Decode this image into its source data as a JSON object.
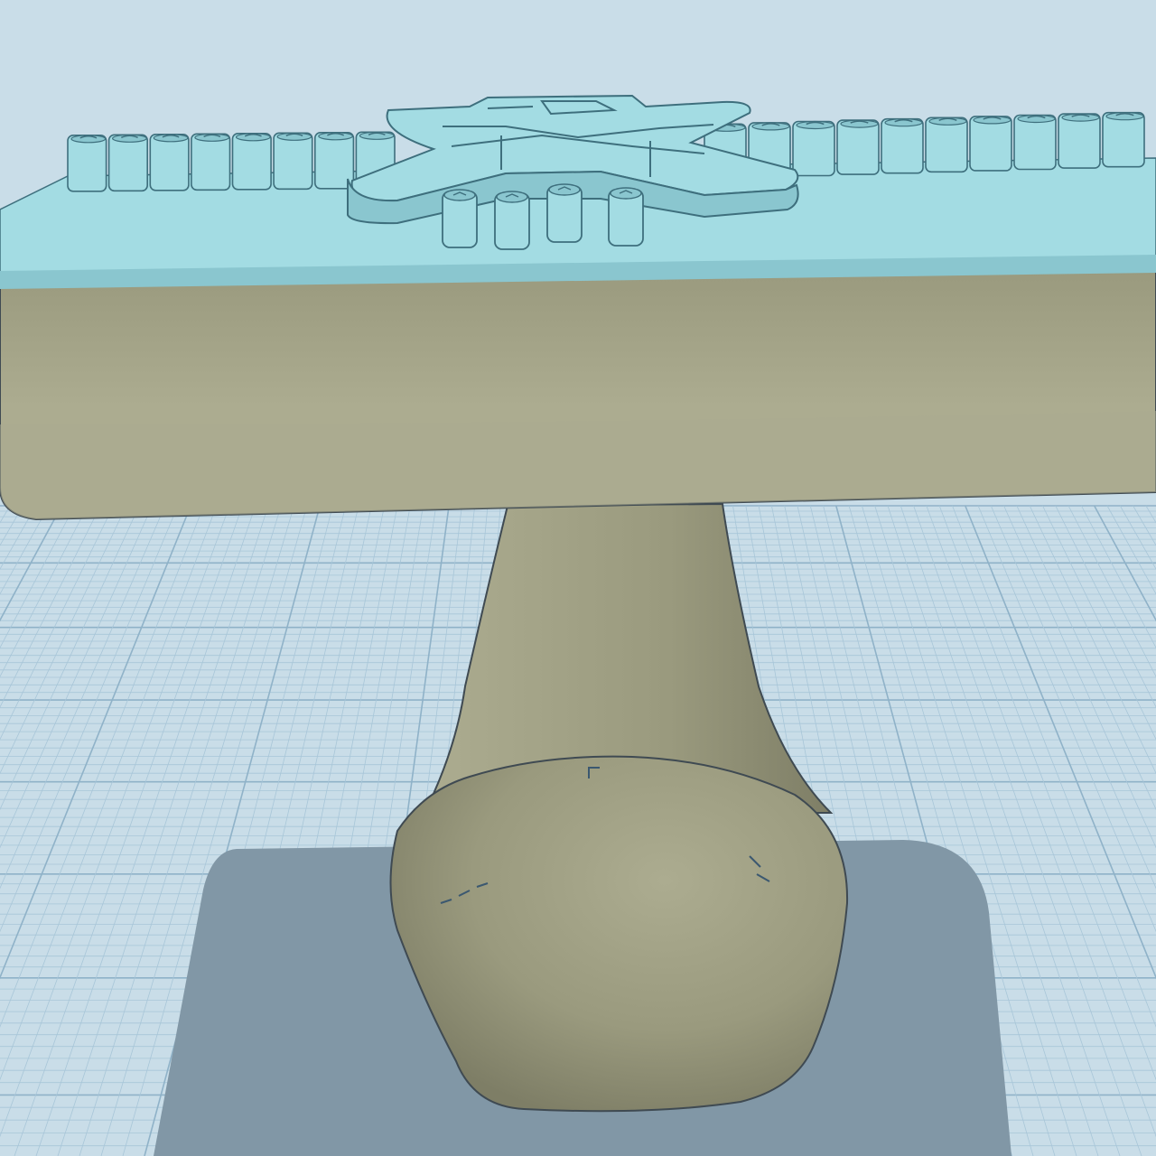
{
  "viewport": {
    "background_color": "#c9dde8",
    "grid_line_color": "#a8c6d8",
    "grid_major_line_color": "#8fb2c8",
    "shadow_color": "#8197a6"
  },
  "model": {
    "plate_top_color": "#a3dce3",
    "plate_edge_color": "#8ac6cf",
    "outline_color": "#3e6f7d",
    "handle_color": "#9a9a7e",
    "handle_light_color": "#acac90",
    "handle_dark_color": "#7e7e66",
    "handle_outline_color": "#3f4a52"
  }
}
